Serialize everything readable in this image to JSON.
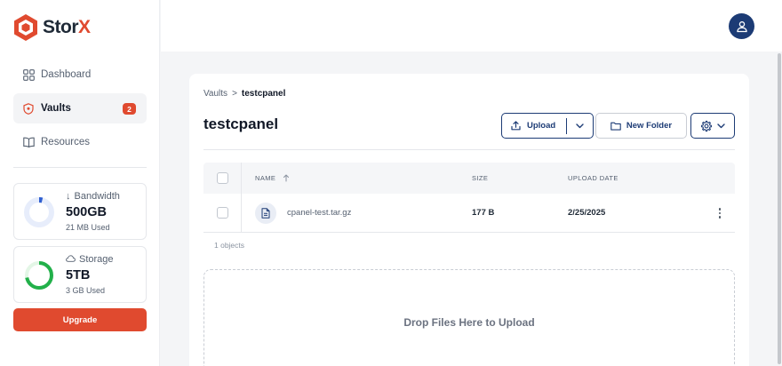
{
  "brand": {
    "name_prefix": "Stor",
    "name_suffix": "X",
    "accent": "#e04a2f",
    "navy": "#1c3b75"
  },
  "sidebar": {
    "items": [
      {
        "label": "Dashboard",
        "icon": "dashboard-grid-icon"
      },
      {
        "label": "Vaults",
        "icon": "vault-shield-icon",
        "badge": "2",
        "active": true
      },
      {
        "label": "Resources",
        "icon": "book-icon"
      }
    ],
    "bandwidth": {
      "title": "Bandwidth",
      "value": "500GB",
      "used": "21 MB Used",
      "icon": "arrow-down-icon",
      "progress": 0.04
    },
    "storage": {
      "title": "Storage",
      "value": "5TB",
      "used": "3 GB Used",
      "icon": "cloud-icon",
      "progress": 0.72
    },
    "upgrade_label": "Upgrade"
  },
  "header": {
    "avatar_icon": "user-icon"
  },
  "breadcrumb": {
    "root": "Vaults",
    "separator": ">",
    "current": "testcpanel"
  },
  "page_title": "testcpanel",
  "toolbar": {
    "upload_label": "Upload",
    "new_folder_label": "New Folder"
  },
  "table": {
    "columns": {
      "name": "NAME",
      "size": "SIZE",
      "date": "UPLOAD DATE"
    },
    "rows": [
      {
        "name": "cpanel-test.tar.gz",
        "size": "177 B",
        "date": "2/25/2025"
      }
    ],
    "count_label": "1 objects"
  },
  "dropzone_label": "Drop Files Here to Upload"
}
